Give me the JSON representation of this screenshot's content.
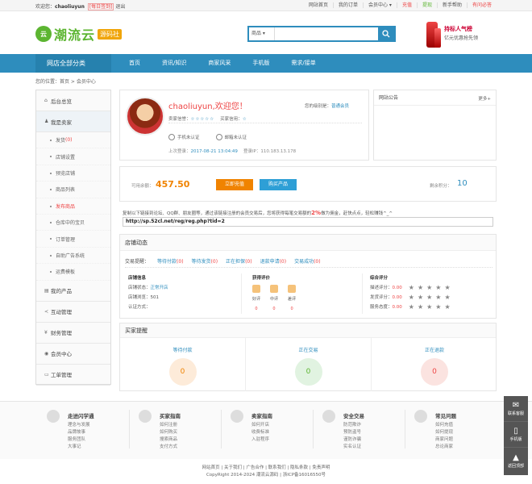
{
  "topbar": {
    "welcome": "欢迎您：",
    "username": "chaoliuyun",
    "tag": "[每日签到]",
    "logout": "退出",
    "links": [
      "网站首页",
      "我的订单",
      "会员中心 ▾",
      "充值",
      "提现",
      "新手帮助",
      "有问必答"
    ]
  },
  "logo": {
    "icon": "云",
    "text": "潮流云",
    "badge": "源码社"
  },
  "search": {
    "select": "商品 ▾",
    "placeholder": ""
  },
  "ad": {
    "line1": "持标人气榜",
    "line2": "亿元优惠抢先领"
  },
  "nav": {
    "all": "网店全部分类",
    "items": [
      "首页",
      "资讯/知识",
      "商家风采",
      "手机版",
      "需求/接单"
    ]
  },
  "breadcrumb": "您的位置：首页 > 会员中心",
  "sidebar": {
    "items": [
      {
        "icon": "⌂",
        "label": "后台总览"
      },
      {
        "icon": "♟",
        "label": "我是卖家"
      }
    ],
    "subs": [
      {
        "label": "发货",
        "num": "(0)"
      },
      {
        "label": "店铺设置",
        "num": ""
      },
      {
        "label": "预览店铺",
        "num": ""
      },
      {
        "label": "商品列表",
        "num": ""
      },
      {
        "label": "发布商品",
        "num": ""
      },
      {
        "label": "仓库中的宝贝",
        "num": ""
      },
      {
        "label": "订单管理",
        "num": ""
      },
      {
        "label": "自助广告系统",
        "num": ""
      },
      {
        "label": "运费模板",
        "num": ""
      }
    ],
    "bottom": [
      {
        "icon": "▤",
        "label": "我的产品"
      },
      {
        "icon": "≺",
        "label": "互动管理"
      },
      {
        "icon": "¥",
        "label": "财务管理"
      },
      {
        "icon": "◉",
        "label": "会员中心"
      },
      {
        "icon": "▭",
        "label": "工单管理"
      }
    ]
  },
  "user": {
    "greeting": "chaoliuyun,欢迎您！",
    "role_label": "您的级别是：",
    "role": "普通会员",
    "seller_credit": "卖家信誉：",
    "seller_stars": "☆☆☆☆☆",
    "buyer_credit": "买家信用：",
    "buyer_stars": "☆",
    "phone_auth": "手机未认证",
    "email_auth": "邮箱未认证",
    "last_login_label": "上次登录：",
    "last_login": "2017-08-21 13:04:49",
    "ip_label": "登录IP：",
    "ip": "110.183.13.178"
  },
  "notice": {
    "title": "网站公告",
    "more": "更多+"
  },
  "balance": {
    "label": "可用余额：",
    "amount": "457.50",
    "recharge": "立即充值",
    "buy": "购买产品",
    "points_label": "剩余积分：",
    "points": "10"
  },
  "promo": {
    "text_a": "复制以下链接到论坛、QQ群、朋友圈等，通过该链接注册的会员交易后，您将获得每笔交易额的",
    "percent": "2%",
    "text_b": "做为佣金，赶快点点，轻松赚钱^_^",
    "url": "http://sp.52cl.net/reg/reg.php?tid=2"
  },
  "shop": {
    "title": "店铺动态",
    "tabs_label": "交易提醒：",
    "tabs": [
      {
        "label": "等待付款",
        "n": "(0)"
      },
      {
        "label": "等待发货",
        "n": "(0)"
      },
      {
        "label": "正在担保",
        "n": "(0)"
      },
      {
        "label": "退款申请",
        "n": "(0)"
      },
      {
        "label": "交易成功",
        "n": "(0)"
      }
    ],
    "info_title": "店铺信息",
    "status_label": "店铺状态：",
    "status": "正常开店",
    "views_label": "店铺浏览：",
    "views": "501",
    "cert_label": "认证方式：",
    "eval_title": "获得评价",
    "good": "好评",
    "good_n": "0",
    "mid": "中评",
    "mid_n": "0",
    "bad": "差评",
    "bad_n": "0",
    "score_title": "综合评分",
    "desc_label": "描述评分：",
    "desc": "0.00",
    "ship_label": "发货评分：",
    "ship": "0.00",
    "serv_label": "服务态度：",
    "serv": "0.00",
    "stars": "★★★★★"
  },
  "buyer": {
    "title": "买家提醒",
    "cells": [
      {
        "label": "等待付款",
        "value": "0"
      },
      {
        "label": "正在交易",
        "value": "0"
      },
      {
        "label": "正在退款",
        "value": "0"
      }
    ]
  },
  "footer": {
    "cols": [
      {
        "title": "走进闪学通",
        "links": [
          "理念与发展",
          "品牌故事",
          "服务团队",
          "大事记"
        ]
      },
      {
        "title": "买家指南",
        "links": [
          "如何注册",
          "如何购买",
          "搜索商品",
          "支付方式"
        ]
      },
      {
        "title": "卖家指南",
        "links": [
          "如何开店",
          "收费标准",
          "入驻程序"
        ]
      },
      {
        "title": "安全交易",
        "links": [
          "防范欺诈",
          "预防盗号",
          "谨防诈骗",
          "实名认证"
        ]
      },
      {
        "title": "常见问题",
        "links": [
          "如何充值",
          "如何提现",
          "商家问题",
          "总论商家"
        ]
      }
    ],
    "links": "网站首页 | 关于我们 | 广告合作 | 联系我们 | 隐私条款 | 免责声明",
    "copyright": "CopyRight 2014-2024 潮流云源码 | 浙ICP备16016550号"
  },
  "floatbar": [
    {
      "icon": "✉",
      "label": "联系客服"
    },
    {
      "icon": "▯",
      "label": "手机版"
    },
    {
      "icon": "▲",
      "label": "返回顶部"
    }
  ],
  "colors": {
    "primary": "#2e8dbd",
    "accent": "#f08300",
    "alert": "#e44"
  }
}
